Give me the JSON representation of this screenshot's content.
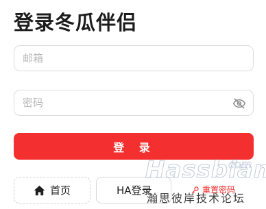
{
  "page": {
    "title": "登录冬瓜伴侣"
  },
  "form": {
    "email_placeholder": "邮箱",
    "password_placeholder": "密码",
    "login_label": "登 录"
  },
  "footer": {
    "home_label": "首页",
    "ha_login_label": "HA登录",
    "reset_label": "重置密码"
  },
  "watermark": {
    "brand": "Hassbian",
    "domain": "com",
    "subtitle": "瀚思彼岸技术论坛"
  },
  "icons": {
    "password_toggle": "eye-off-icon",
    "home": "home-icon",
    "reset": "key-icon"
  },
  "colors": {
    "accent": "#f42f2f",
    "border": "#dcdcdc",
    "placeholder": "#b8b8b8"
  }
}
